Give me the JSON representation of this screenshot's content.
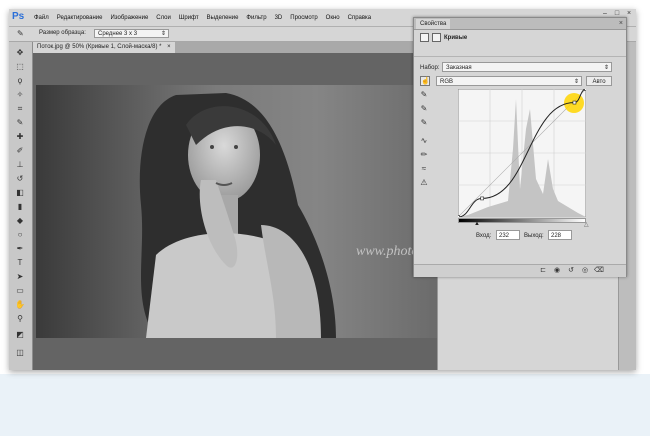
{
  "app": {
    "logo": "Ps",
    "menu": [
      "Файл",
      "Редактирование",
      "Изображение",
      "Слои",
      "Шрифт",
      "Выделение",
      "Фильтр",
      "3D",
      "Просмотр",
      "Окно",
      "Справка"
    ],
    "window_buttons": [
      "–",
      "□",
      "×"
    ]
  },
  "options_bar": {
    "sample_size_label": "Размер образца:",
    "sample_size_value": "Среднее 3 х 3"
  },
  "document": {
    "tab_title": "Поток.jpg @ 50% (Кривые 1, Слой-маска/8) *",
    "tab_close": "×"
  },
  "watermark": "www.photoshopsunduchok.ru",
  "properties_panel": {
    "tab": "Свойства",
    "close": "×",
    "title": "Кривые",
    "preset_label": "Набор:",
    "preset_value": "Заказная",
    "channel_value": "RGB",
    "auto_button": "Авто",
    "input_label": "Вход:",
    "input_value": "232",
    "output_label": "Выход:",
    "output_value": "228"
  },
  "curve": {
    "axis_max": 255,
    "points": [
      [
        0,
        0
      ],
      [
        48,
        37
      ],
      [
        232,
        228
      ],
      [
        255,
        255
      ]
    ]
  },
  "colors": {
    "accent_highlight": "#ffd500",
    "ps_blue": "#2b6fd8",
    "panel_bg": "#d6d6d6"
  },
  "icons": {
    "tools": [
      "move",
      "marquee",
      "lasso",
      "quick-select",
      "crop",
      "eyedropper",
      "healing",
      "brush",
      "stamp",
      "history-brush",
      "eraser",
      "gradient",
      "blur",
      "dodge",
      "pen",
      "type",
      "path-select",
      "shape",
      "hand",
      "zoom"
    ],
    "panel_tools": [
      "target-adjust",
      "black-eyedropper",
      "gray-eyedropper",
      "white-eyedropper",
      "curve-edit",
      "pencil-edit",
      "smooth",
      "clipping-warning"
    ],
    "footer": [
      "clip-to-layer",
      "view-previous",
      "reset",
      "visibility",
      "delete"
    ]
  }
}
